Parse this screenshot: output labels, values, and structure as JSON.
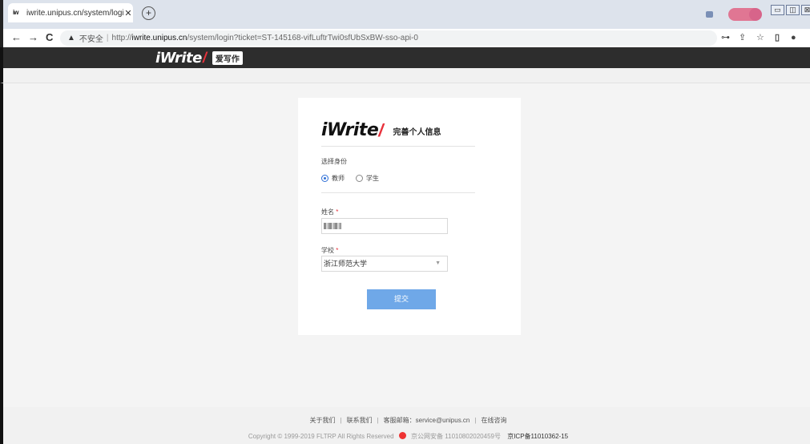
{
  "browser": {
    "tab_title": "iwrite.unipus.cn/system/login?",
    "tab_close": "✕",
    "new_tab": "+",
    "nav_back": "←",
    "nav_forward": "→",
    "nav_reload": "C",
    "security_warning_icon": "▲",
    "insecure_label": "不安全",
    "url_separator": "|",
    "url_scheme": "http://",
    "url_host": "iwrite.unipus.cn",
    "url_path": "/system/login?ticket=ST-145168-vifLuftrTwi0sfUbSxBW-sso-api-0",
    "window_minimize": "▭",
    "window_restore": "◫",
    "window_close": "⊠",
    "tool_key": "⊶",
    "tool_share": "⇪",
    "tool_star": "☆",
    "tool_sidepanel": "▯",
    "tool_profile": "●",
    "tool_menu": "⋮"
  },
  "site": {
    "logo_word": "iWrite",
    "logo_slash": "/",
    "logo_badge": "爱写作"
  },
  "form": {
    "logo_word": "iWrite",
    "logo_slash": "/",
    "title": "完善个人信息",
    "identity_label": "选择身份",
    "role_options": [
      "教师",
      "学生"
    ],
    "selected_role": "教师",
    "name_label": "姓名",
    "required_mark": "*",
    "school_label": "学校",
    "school_value": "浙江师范大学",
    "select_caret": "▼",
    "submit_label": "提交"
  },
  "footer": {
    "links": [
      "关于我们",
      "联系我们",
      "客服邮箱：service@unipus.cn",
      "在线咨询"
    ],
    "copyright": "Copyright © 1999-2019 FLTRP All Rights Reserved",
    "police_record": "京公网安备 11010802020459号",
    "icp_record": "京ICP备11010362-15"
  },
  "colors": {
    "accent": "#2f6fd6",
    "submit_bg": "#6fa8e8",
    "logo_red": "#e8323c",
    "header_bg": "#2d2d2d"
  }
}
